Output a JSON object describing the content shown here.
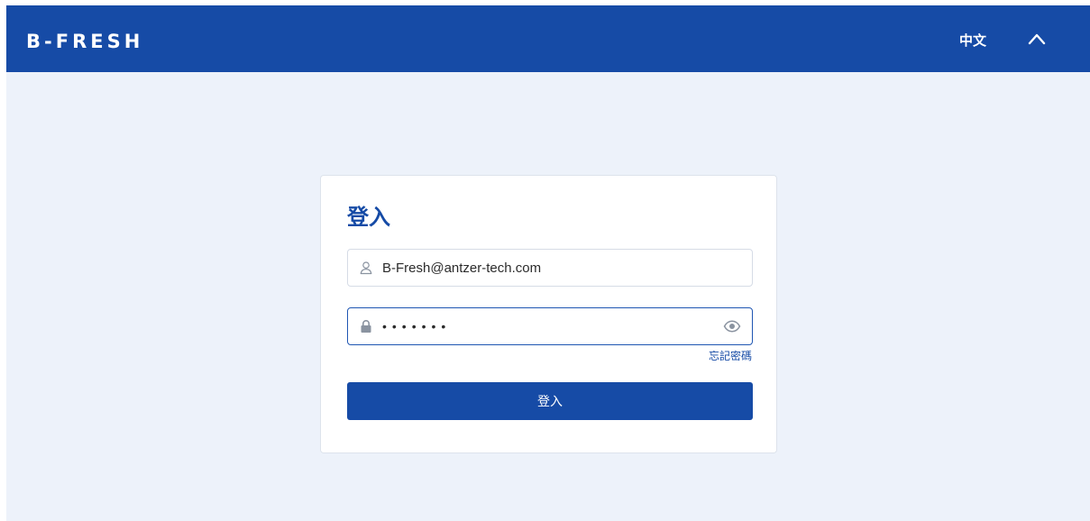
{
  "header": {
    "logo": "B-FRESH",
    "language": "中文",
    "collapse_icon": "chevron-up-icon"
  },
  "login": {
    "title": "登入",
    "email": {
      "value": "B-Fresh@antzer-tech.com",
      "icon": "user-icon"
    },
    "password": {
      "value": "•••••••",
      "icon": "lock-icon",
      "toggle_icon": "eye-icon"
    },
    "forgot_label": "忘記密碼",
    "submit_label": "登入"
  },
  "colors": {
    "brand": "#164ba6",
    "background": "#edf2fa"
  }
}
